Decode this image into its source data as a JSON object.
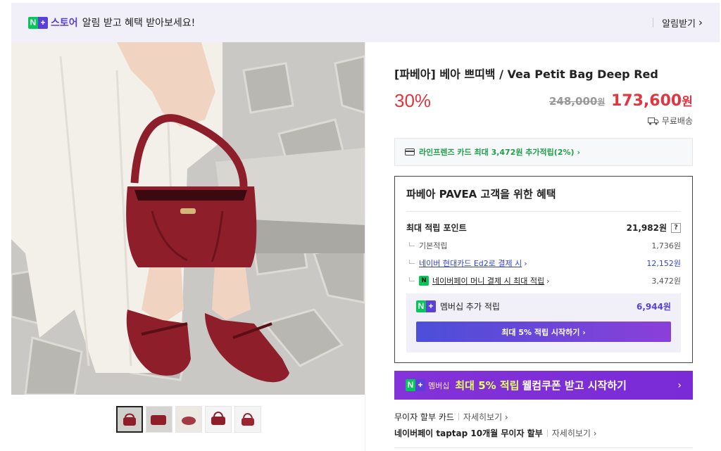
{
  "topbar": {
    "badge_n": "N",
    "badge_plus": "+",
    "store": "스토어",
    "message": "알림 받고 혜택 받아보세요!",
    "alarm_button": "알림받기",
    "alarm_arrow": "›"
  },
  "product": {
    "title": "[파베아] 베아 쁘띠백 / Vea Petit Bag Deep Red",
    "discount": "30%",
    "original_price": "248,000",
    "original_unit": "원",
    "sale_price": "173,600",
    "sale_unit": "원",
    "shipping": "무료배송",
    "shipping_icon": "truck-icon",
    "image_colors": [
      "#8e1f2a",
      "#f3f0ea",
      "#c9c8c4"
    ]
  },
  "thumbnails": [
    "thumb-1",
    "thumb-2",
    "thumb-3",
    "thumb-4",
    "thumb-5"
  ],
  "card_offer": {
    "text": "라인프렌즈 카드 최대 3,472원 추가적립(2%)",
    "arrow": "›"
  },
  "benefit": {
    "heading": "파베아 PAVEA 고객을 위한 혜택",
    "max_points_label": "최대 적립 포인트",
    "max_points_value": "21,982원",
    "help": "?",
    "rows": [
      {
        "label": "기본적립",
        "value": "1,736원"
      },
      {
        "label": "네이버 현대카드 Ed2로 결제 시",
        "arrow": "›",
        "value": "12,152원"
      },
      {
        "badge": "N",
        "label": "네이버페이 머니 결제 시 최대 적립",
        "arrow": "›",
        "value": "3,472원"
      }
    ],
    "membership": {
      "label": "멤버십 추가 적립",
      "value": "6,944원",
      "button": "최대 5% 적립 시작하기 ›"
    }
  },
  "banner": {
    "tag": "멤버십",
    "highlight": "최대 5% 적립",
    "text": "웰컴쿠폰 받고 시작하기",
    "arrow": "›"
  },
  "info": [
    {
      "label": "무이자 할부 카드",
      "more": "자세히보기 ›"
    },
    {
      "label": "네이버페이 taptap 10개월 무이자 할부",
      "more": "자세히보기 ›"
    }
  ],
  "colors": {
    "accent_purple": "#5a3fd8",
    "naver_green": "#03c75a",
    "price_red": "#e0363f"
  }
}
